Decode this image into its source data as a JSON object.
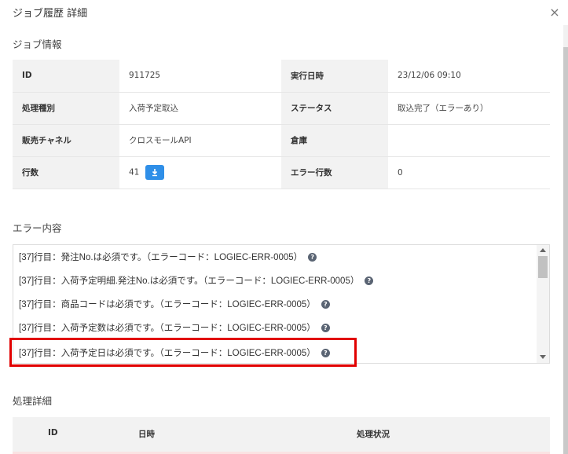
{
  "modal": {
    "title": "ジョブ履歴 詳細",
    "close_label": "×"
  },
  "job_info": {
    "heading": "ジョブ情報",
    "rows": [
      {
        "label1": "ID",
        "value1": "911725",
        "label2": "実行日時",
        "value2": "23/12/06 09:10"
      },
      {
        "label1": "処理種別",
        "value1": "入荷予定取込",
        "label2": "ステータス",
        "value2": "取込完了（エラーあり）"
      },
      {
        "label1": "販売チャネル",
        "value1": "クロスモールAPI",
        "label2": "倉庫",
        "value2": ""
      },
      {
        "label1": "行数",
        "value1": "41",
        "label2": "エラー行数",
        "value2": "0"
      }
    ]
  },
  "errors": {
    "heading": "エラー内容",
    "help_glyph": "?",
    "lines": [
      "[37]行目：発注No.は必須です。（エラーコード：LOGIEC-ERR-0005）",
      "[37]行目：入荷予定明細.発注No.は必須です。（エラーコード：LOGIEC-ERR-0005）",
      "[37]行目：商品コードは必須です。（エラーコード：LOGIEC-ERR-0005）",
      "[37]行目：入荷予定数は必須です。（エラーコード：LOGIEC-ERR-0005）",
      "[37]行目：入荷予定日は必須です。（エラーコード：LOGIEC-ERR-0005）"
    ],
    "highlighted_line": 4,
    "highlight_color": "#e10000"
  },
  "details": {
    "heading": "処理詳細",
    "columns": [
      "ID",
      "日時",
      "処理状況"
    ]
  },
  "colors": {
    "accent": "#2f8fe8",
    "label_bg": "#f2f2f2"
  }
}
